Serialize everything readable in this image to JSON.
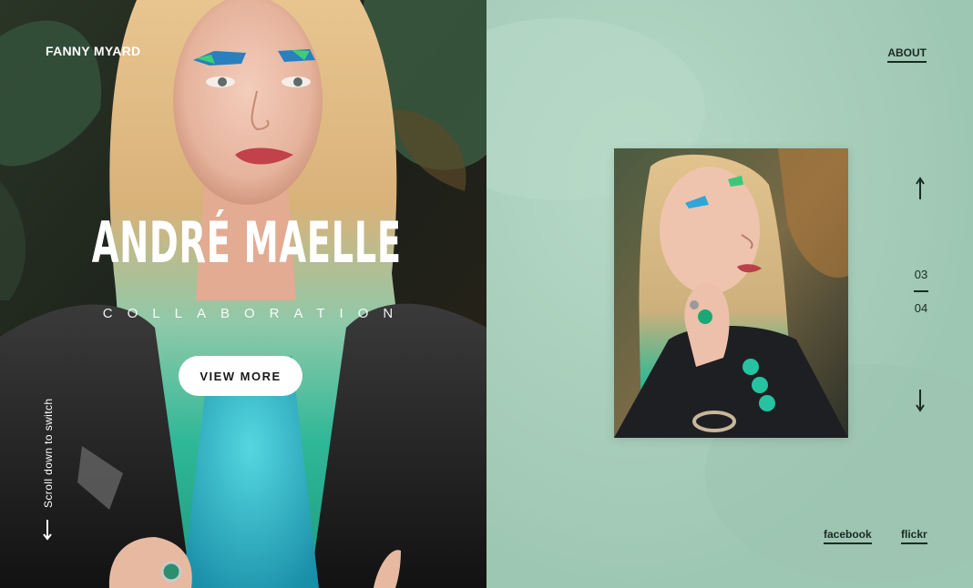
{
  "brand": {
    "name": "FANNY MYARD"
  },
  "hero": {
    "title": "ANDRÉ MAELLE",
    "subtitle": "COLLABORATION",
    "cta_label": "VIEW MORE",
    "scroll_hint": "Scroll down to switch"
  },
  "nav": {
    "about_label": "ABOUT"
  },
  "pager": {
    "current": "03",
    "total": "04"
  },
  "social": {
    "facebook_label": "facebook",
    "flickr_label": "flickr"
  },
  "colors": {
    "side_background": "#a9cfbd",
    "text_dark": "#1a2a24",
    "hair_teal": "#2fb898",
    "hero_white": "#ffffff"
  },
  "icons": {
    "scroll": "arrow-down-icon",
    "prev": "arrow-up-icon",
    "next": "arrow-down-icon"
  }
}
